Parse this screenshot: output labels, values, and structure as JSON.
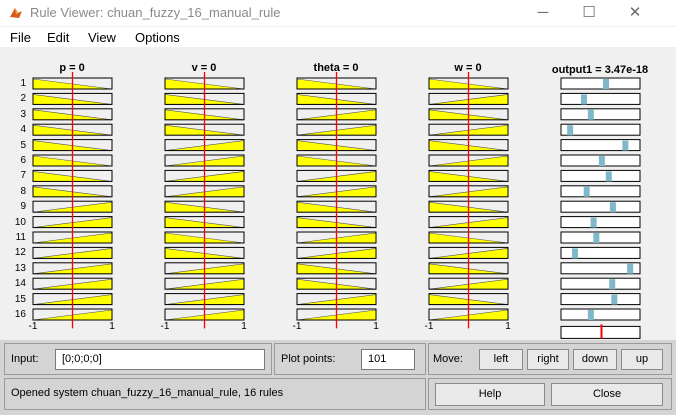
{
  "window": {
    "title": "Rule Viewer: chuan_fuzzy_16_manual_rule",
    "controls": [
      "─",
      "☐",
      "✕"
    ]
  },
  "menu": [
    "File",
    "Edit",
    "View",
    "Options"
  ],
  "plots": {
    "inputs": [
      {
        "header": "p = 0",
        "tick_min": "-1",
        "tick_max": "1",
        "value": 0
      },
      {
        "header": "v = 0",
        "tick_min": "-1",
        "tick_max": "1",
        "value": 0
      },
      {
        "header": "theta = 0",
        "tick_min": "-1",
        "tick_max": "1",
        "value": 0
      },
      {
        "header": "w = 0",
        "tick_min": "-1",
        "tick_max": "1",
        "value": 0
      }
    ],
    "output_header": "output1 = 3.47e-18",
    "output_value": 3.47e-18,
    "rule_numbers": [
      "1",
      "2",
      "3",
      "4",
      "5",
      "6",
      "7",
      "8",
      "9",
      "10",
      "11",
      "12",
      "13",
      "14",
      "15",
      "16"
    ],
    "rules": [
      {
        "p": "N",
        "v": "N",
        "theta": "N",
        "w": "N",
        "out": 0.58
      },
      {
        "p": "N",
        "v": "N",
        "theta": "N",
        "w": "P",
        "out": 0.26
      },
      {
        "p": "N",
        "v": "N",
        "theta": "P",
        "w": "N",
        "out": 0.36
      },
      {
        "p": "N",
        "v": "N",
        "theta": "P",
        "w": "P",
        "out": 0.06
      },
      {
        "p": "N",
        "v": "P",
        "theta": "N",
        "w": "N",
        "out": 0.86
      },
      {
        "p": "N",
        "v": "P",
        "theta": "N",
        "w": "P",
        "out": 0.52
      },
      {
        "p": "N",
        "v": "P",
        "theta": "P",
        "w": "N",
        "out": 0.62
      },
      {
        "p": "N",
        "v": "P",
        "theta": "P",
        "w": "P",
        "out": 0.3
      },
      {
        "p": "P",
        "v": "N",
        "theta": "N",
        "w": "N",
        "out": 0.68
      },
      {
        "p": "P",
        "v": "N",
        "theta": "N",
        "w": "P",
        "out": 0.4
      },
      {
        "p": "P",
        "v": "N",
        "theta": "P",
        "w": "N",
        "out": 0.44
      },
      {
        "p": "P",
        "v": "N",
        "theta": "P",
        "w": "P",
        "out": 0.13
      },
      {
        "p": "P",
        "v": "P",
        "theta": "N",
        "w": "N",
        "out": 0.93
      },
      {
        "p": "P",
        "v": "P",
        "theta": "N",
        "w": "P",
        "out": 0.67
      },
      {
        "p": "P",
        "v": "P",
        "theta": "P",
        "w": "N",
        "out": 0.7
      },
      {
        "p": "P",
        "v": "P",
        "theta": "P",
        "w": "P",
        "out": 0.36
      }
    ],
    "colors": {
      "fill": "#ffff00",
      "line": "#ff0000",
      "out_fill": "#7fb8c8",
      "box_border": "#000000"
    }
  },
  "controls": {
    "input_label": "Input:",
    "input_value": "[0;0;0;0]",
    "plot_points_label": "Plot points:",
    "plot_points_value": "101",
    "move_label": "Move:",
    "move_buttons": [
      "left",
      "right",
      "down",
      "up"
    ],
    "status": "Opened system chuan_fuzzy_16_manual_rule, 16 rules",
    "help_label": "Help",
    "close_label": "Close"
  }
}
